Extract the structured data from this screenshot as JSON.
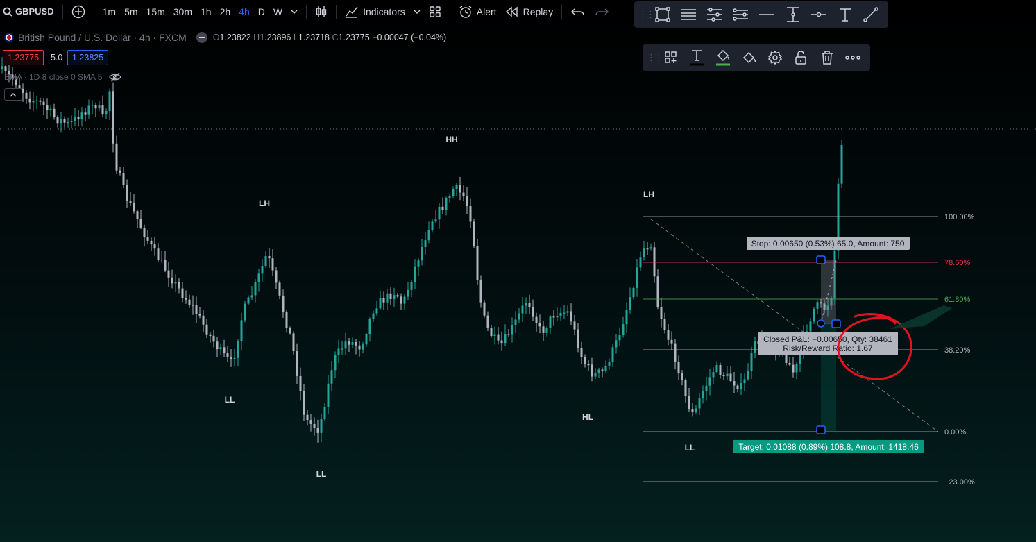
{
  "toolbar": {
    "symbol": "GBPUSD",
    "timeframes": [
      "1m",
      "5m",
      "15m",
      "30m",
      "1h",
      "2h",
      "4h",
      "D",
      "W"
    ],
    "active_timeframe": "4h",
    "indicators_label": "Indicators",
    "alert_label": "Alert",
    "replay_label": "Replay"
  },
  "legend": {
    "title": "British Pound / U.S. Dollar · 4h · FXCM",
    "open_key": "O",
    "open": "1.23822",
    "high_key": "H",
    "high": "1.23896",
    "low_key": "L",
    "low": "1.23718",
    "close_key": "C",
    "close": "1.23775",
    "change": "−0.00047 (−0.04%)",
    "bid": "1.23775",
    "spread": "5.0",
    "ask": "1.23825",
    "indicator": "EMA · 1D 8 close 0 SMA 5"
  },
  "swing_labels": [
    {
      "text": "LH"
    },
    {
      "text": "HH"
    },
    {
      "text": "LH"
    },
    {
      "text": "LL"
    },
    {
      "text": "LL"
    },
    {
      "text": "HL"
    },
    {
      "text": "LL"
    }
  ],
  "fib_levels": [
    {
      "label": "100.00%",
      "color": "#b2b5be"
    },
    {
      "label": "78.60%",
      "color": "#f23645"
    },
    {
      "label": "61.80%",
      "color": "#4caf50"
    },
    {
      "label": "38.20%",
      "color": "#b2b5be"
    },
    {
      "label": "0.00%",
      "color": "#b2b5be"
    },
    {
      "label": "−23.00%",
      "color": "#b2b5be"
    }
  ],
  "position_tool": {
    "stop_label": "Stop: 0.00650 (0.53%) 65.0, Amount: 750",
    "target_label": "Target: 0.01088 (0.89%) 108.8, Amount: 1418.46",
    "pnl_line1": "Closed P&L: −0.00650, Qty: 38461",
    "pnl_line2": "Risk/Reward Ratio: 1.67"
  },
  "colors": {
    "up_candle": "#26a69a",
    "down_candle": "#b2b5be",
    "accent": "#2962ff",
    "annotation_red": "#e0141e",
    "target_green": "#089981"
  },
  "drawing_tools": [
    "rectangle-icon",
    "parallel-lines-icon",
    "pitchfork-icon",
    "fib-channel-icon",
    "horizontal-ray-icon",
    "vertical-line-icon",
    "trend-segment-icon",
    "text-icon",
    "trend-line-icon"
  ],
  "object_tools": [
    "template-icon",
    "text-style-icon",
    "paint-bucket-icon",
    "fill-icon",
    "gear-icon",
    "unlock-icon",
    "trash-icon",
    "more-icon"
  ]
}
